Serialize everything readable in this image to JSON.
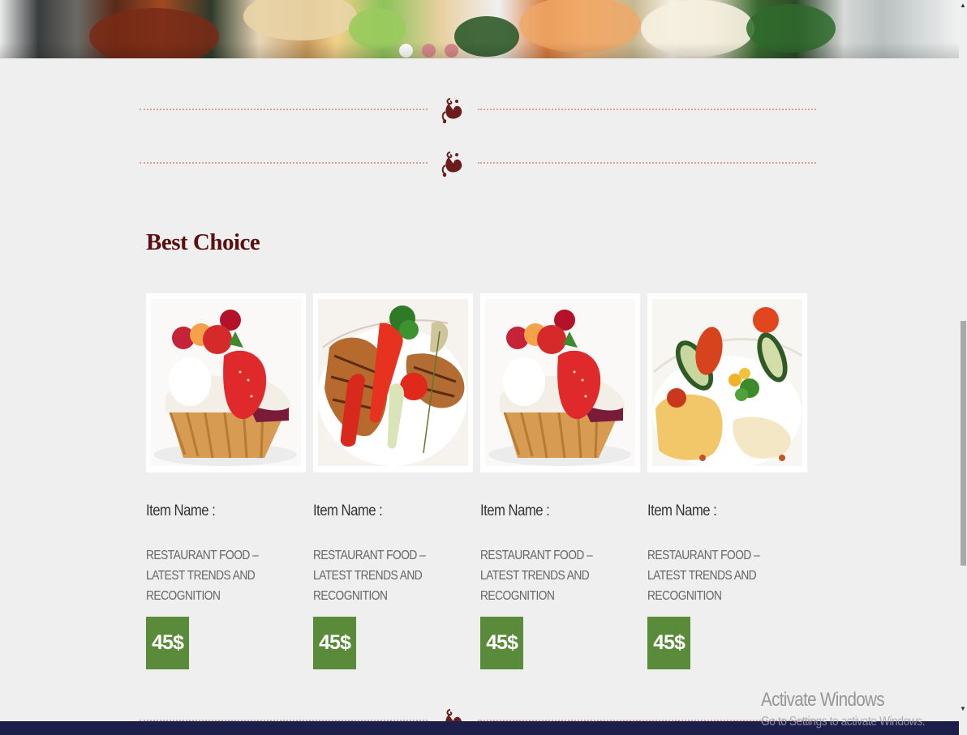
{
  "hero": {
    "slides": [
      {
        "active": true
      },
      {
        "active": false
      },
      {
        "active": false
      }
    ]
  },
  "section": {
    "title": "Best Choice"
  },
  "products": [
    {
      "image_icon": "strawberry-tart-image",
      "name_label": "Item Name :",
      "description": "RESTAURANT FOOD – LATEST TRENDS AND RECOGNITION",
      "price": "45$"
    },
    {
      "image_icon": "grilled-fish-plate-image",
      "name_label": "Item Name :",
      "description": "RESTAURANT FOOD – LATEST TRENDS AND RECOGNITION",
      "price": "45$"
    },
    {
      "image_icon": "strawberry-tart-image",
      "name_label": "Item Name :",
      "description": "RESTAURANT FOOD – LATEST TRENDS AND RECOGNITION",
      "price": "45$"
    },
    {
      "image_icon": "grilled-vegetables-plate-image",
      "name_label": "Item Name :",
      "description": "RESTAURANT FOOD – LATEST TRENDS AND RECOGNITION",
      "price": "45$"
    }
  ],
  "colors": {
    "title": "#5c0f0f",
    "price_badge": "#5a8b3a",
    "divider_dots": "#e39d9d",
    "footer": "#1c1f4a"
  },
  "watermark": {
    "title": "Activate Windows",
    "subtitle": "Go to Settings to activate Windows."
  }
}
